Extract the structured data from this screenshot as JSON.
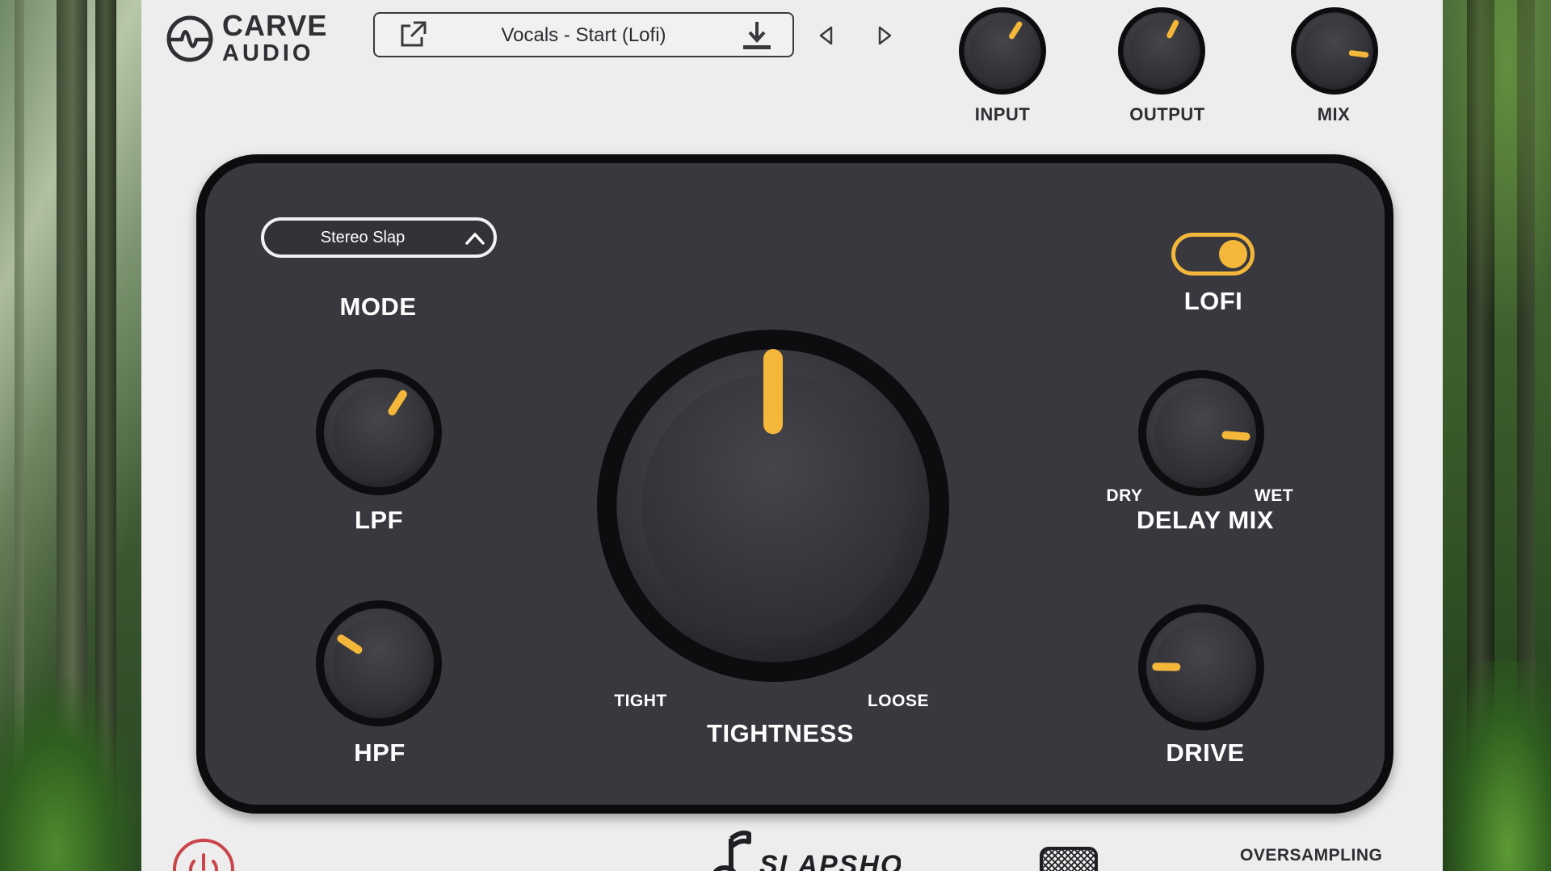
{
  "brand": {
    "line1": "CARVE",
    "line2": "AUDIO"
  },
  "preset": {
    "name": "Vocals - Start (Lofi)"
  },
  "top_knobs": [
    {
      "id": "input",
      "label": "INPUT",
      "value": 0.62
    },
    {
      "id": "output",
      "label": "OUTPUT",
      "value": 0.6
    },
    {
      "id": "mix",
      "label": "MIX",
      "value": 0.86
    }
  ],
  "mode": {
    "label": "MODE",
    "value": "Stereo Slap"
  },
  "lofi": {
    "label": "LOFI",
    "on": true
  },
  "knobs": {
    "lpf": {
      "label": "LPF",
      "value": 0.62
    },
    "hpf": {
      "label": "HPF",
      "value": 0.29
    },
    "tightness": {
      "label": "TIGHTNESS",
      "value": 0.5,
      "min_label": "TIGHT",
      "max_label": "LOOSE"
    },
    "delay_mix": {
      "label": "DELAY MIX",
      "value": 0.85,
      "min_label": "DRY",
      "max_label": "WET"
    },
    "drive": {
      "label": "DRIVE",
      "value": 0.17
    }
  },
  "bottom": {
    "brand_text": "SLAPSHOT",
    "oversampling_label": "OVERSAMPLING"
  },
  "colors": {
    "accent": "#f4b73a",
    "panel": "#38383e",
    "frame": "#0c0c0e",
    "chrome": "#ededed",
    "power": "#c9454a"
  }
}
